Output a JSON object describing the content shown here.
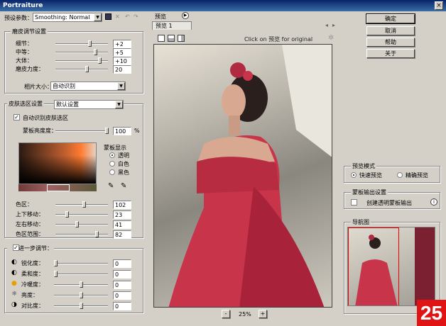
{
  "window": {
    "title": "Portraiture"
  },
  "preset": {
    "label": "预设参数：",
    "value": "Smoothing: Normal"
  },
  "preview": {
    "header": "预览",
    "tab": "预览 1",
    "hint": "Click on 预览 for original",
    "zoom": "25%",
    "zoom_minus": "-",
    "zoom_plus": "+"
  },
  "detail": {
    "title": "磨皮调节设置",
    "rows": [
      {
        "label": "细节：",
        "value": "+2"
      },
      {
        "label": "中等：",
        "value": "+5"
      },
      {
        "label": "大体：",
        "value": "+10"
      },
      {
        "label": "磨皮力度：",
        "value": "20"
      }
    ],
    "size_label": "相片大小：",
    "size_value": "自动识别"
  },
  "skin": {
    "title": "皮肤选区设置",
    "mode_value": "默认设置",
    "auto_label": "自动识别皮肤选区",
    "transparency_label": "蒙板亮度度：",
    "transparency_value": "100",
    "percent": "%",
    "mask_title": "蒙板显示",
    "mask_options": [
      "透明",
      "白色",
      "黑色"
    ],
    "rows": [
      {
        "label": "色区：",
        "value": "102"
      },
      {
        "label": "上下移动：",
        "value": "23"
      },
      {
        "label": "左右移动：",
        "value": "41"
      },
      {
        "label": "色区范围：",
        "value": "82"
      }
    ]
  },
  "enhance": {
    "title": "进一步调节：",
    "rows": [
      {
        "label": "锐化度：",
        "value": "0",
        "icon": "half-circle-icon"
      },
      {
        "label": "柔和度：",
        "value": "0",
        "icon": "half-circle-icon"
      },
      {
        "label": "冷暖度：",
        "value": "0",
        "icon": "sun-icon"
      },
      {
        "label": "亮度：",
        "value": "0",
        "icon": "brightness-icon"
      },
      {
        "label": "对比度：",
        "value": "0",
        "icon": "contrast-icon"
      }
    ]
  },
  "buttons": {
    "ok": "确定",
    "cancel": "取消",
    "help": "帮助",
    "about": "关于"
  },
  "preview_mode": {
    "title": "预览模式",
    "fast": "快速预览",
    "precise": "精确预览"
  },
  "output": {
    "title": "蒙板输出设置",
    "checkbox": "创建透明蒙板输出"
  },
  "navigator": {
    "title": "导航图"
  },
  "watermark": {
    "number": "25"
  },
  "colors": {
    "accent": "#0a246a",
    "dress": "#c8344a",
    "watermark": "#e01414"
  }
}
